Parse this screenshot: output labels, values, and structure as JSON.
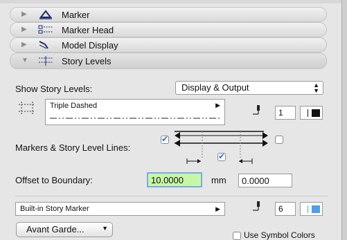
{
  "sections": [
    {
      "label": "Marker",
      "icon": "marker-triangle-icon"
    },
    {
      "label": "Marker Head",
      "icon": "marker-head-icon"
    },
    {
      "label": "Model Display",
      "icon": "model-display-icon"
    },
    {
      "label": "Story Levels",
      "icon": "story-levels-icon"
    }
  ],
  "story_levels": {
    "show_label": "Show Story Levels:",
    "show_value": "Display & Output",
    "line_type": "Triple Dashed",
    "pen_value": "1",
    "markers_label": "Markers & Story Level Lines:",
    "offset_label": "Offset to Boundary:",
    "offset_value": "10.0000",
    "offset_unit": "mm",
    "offset_value2": "0.0000",
    "marker_type": "Built-in Story Marker",
    "marker_pen": "6",
    "font_button": "Avant Garde...",
    "symbol_colors_label": "Use Symbol Colors"
  },
  "colors": {
    "highlight_input": "#c6f7a6",
    "accent_blue": "#2a6fd3"
  }
}
